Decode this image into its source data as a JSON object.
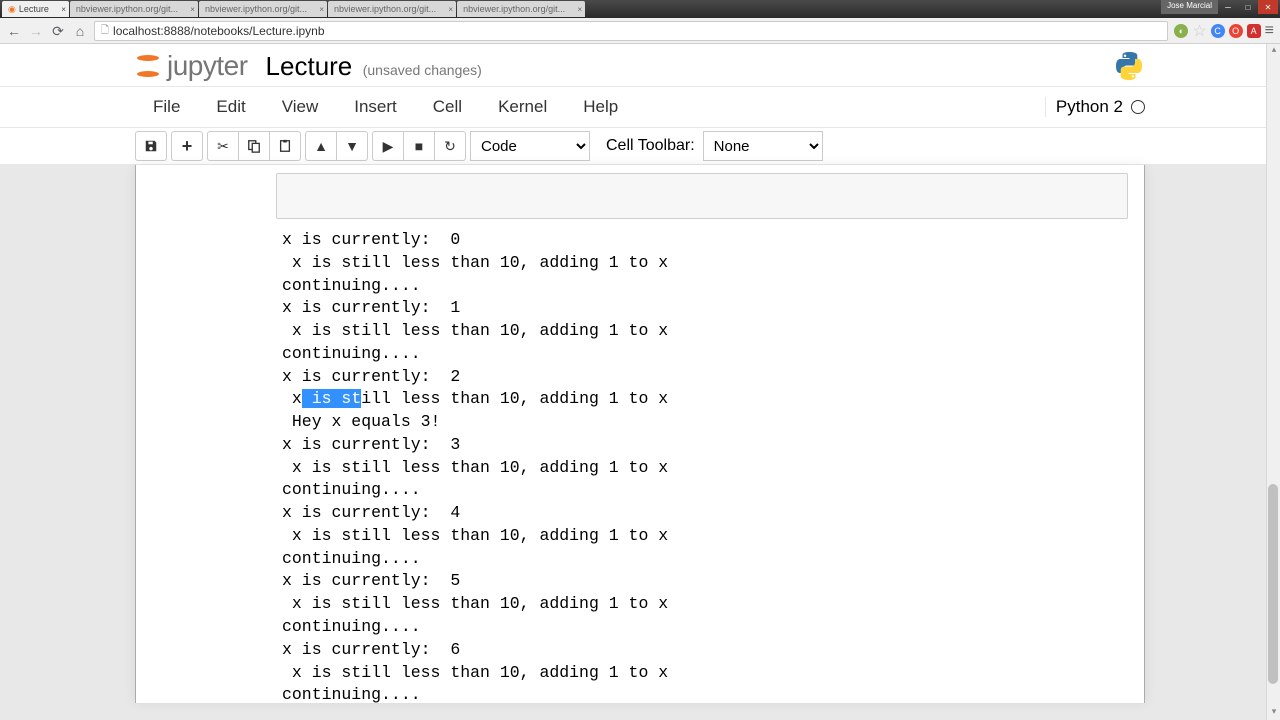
{
  "browser": {
    "tabs": [
      {
        "title": "Lecture",
        "active": true
      },
      {
        "title": "nbviewer.ipython.org/git...",
        "active": false
      },
      {
        "title": "nbviewer.ipython.org/git...",
        "active": false
      },
      {
        "title": "nbviewer.ipython.org/git...",
        "active": false
      },
      {
        "title": "nbviewer.ipython.org/git...",
        "active": false
      }
    ],
    "user": "Jose Marcial",
    "url": "localhost:8888/notebooks/Lecture.ipynb"
  },
  "header": {
    "logo_text": "jupyter",
    "notebook_name": "Lecture",
    "save_status": "(unsaved changes)"
  },
  "menu": {
    "items": [
      "File",
      "Edit",
      "View",
      "Insert",
      "Cell",
      "Kernel",
      "Help"
    ],
    "kernel_name": "Python 2"
  },
  "toolbar": {
    "cell_type": "Code",
    "cell_toolbar_label": "Cell Toolbar:",
    "cell_toolbar_value": "None"
  },
  "output": {
    "lines": [
      "x is currently:  0",
      " x is still less than 10, adding 1 to x",
      "continuing....",
      "x is currently:  1",
      " x is still less than 10, adding 1 to x",
      "continuing....",
      "x is currently:  2",
      {
        "prefix": " x",
        "highlight": " is st",
        "suffix": "ill less than 10, adding 1 to x"
      },
      " Hey x equals 3!",
      "x is currently:  3",
      " x is still less than 10, adding 1 to x",
      "continuing....",
      "x is currently:  4",
      " x is still less than 10, adding 1 to x",
      "continuing....",
      "x is currently:  5",
      " x is still less than 10, adding 1 to x",
      "continuing....",
      "x is currently:  6",
      " x is still less than 10, adding 1 to x",
      "continuing...."
    ]
  }
}
